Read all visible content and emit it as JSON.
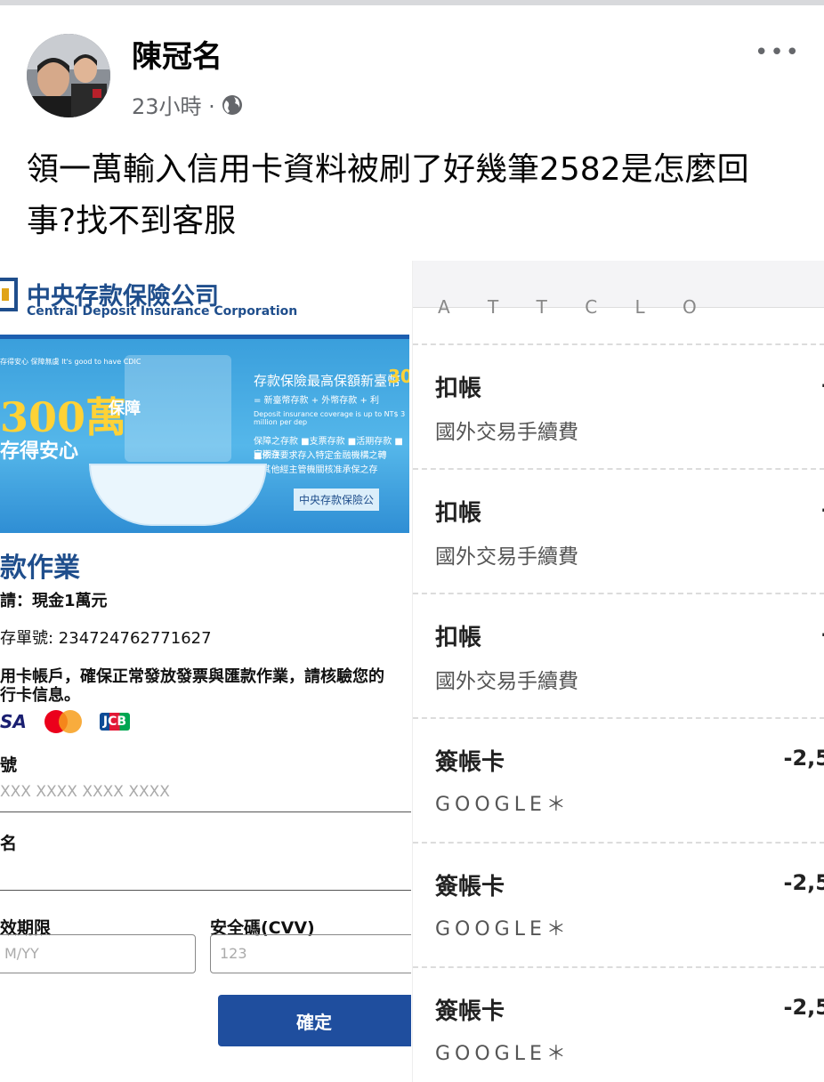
{
  "post": {
    "author": "陳冠名",
    "time": "23小時 ·",
    "privacy_icon": "globe-icon",
    "more_icon": "more-icon",
    "more": "•••",
    "text": "領一萬輸入信用卡資料被刷了好幾筆2582是怎麼回事?找不到客服"
  },
  "left_screenshot": {
    "logo_zh": "中央存款保險公司",
    "logo_en": "Central Deposit Insurance Corporation",
    "banner": {
      "top_text": "存得安心 保障無虞 It's good to have CDIC",
      "amount": "300萬",
      "protect": "保障",
      "safe": "存得安心",
      "right_title": "存款保險最高保額新臺幣",
      "right_title_value": "30",
      "right_line1": "= 新臺幣存款 + 外幣存款 + 利",
      "right_line2": "Deposit insurance coverage is up to NT$ 3 million per dep",
      "right_line3": "保障之存款 ■支票存款 ■活期存款 ■定期存",
      "right_line4": "■依法要求存入特定金融機構之轉",
      "right_line5": "■其他經主管機關核准承保之存",
      "corner": "中央存款保險公"
    },
    "form_title": "款作業",
    "apply": "請：現金1萬元",
    "order_no": "存單號: 234724762771627",
    "notice_line1": "用卡帳戶，確保正常發放發票與匯款作業，請核驗您的",
    "notice_line2": "行卡信息。",
    "cards": [
      "SA",
      "MasterCard",
      "JCB"
    ],
    "card_no_label": "號",
    "card_no_placeholder": "XXX XXXX XXXX XXXX",
    "name_label": "名",
    "expiry_label": "效期限",
    "expiry_placeholder": "M/YY",
    "cvv_label": "安全碼(CVV)",
    "cvv_placeholder": "123",
    "confirm": "確定"
  },
  "right_screenshot": {
    "cut_text": "A T T C L O",
    "transactions": [
      {
        "title": "扣帳",
        "sub": "國外交易手續費",
        "amount": "-"
      },
      {
        "title": "扣帳",
        "sub": "國外交易手續費",
        "amount": "-"
      },
      {
        "title": "扣帳",
        "sub": "國外交易手續費",
        "amount": "-"
      },
      {
        "title": "簽帳卡",
        "sub": "GOOGLE＊",
        "amount": "-2,5"
      },
      {
        "title": "簽帳卡",
        "sub": "GOOGLE＊",
        "amount": "-2,5"
      },
      {
        "title": "簽帳卡",
        "sub": "GOOGLE＊",
        "amount": "-2,5"
      }
    ]
  }
}
